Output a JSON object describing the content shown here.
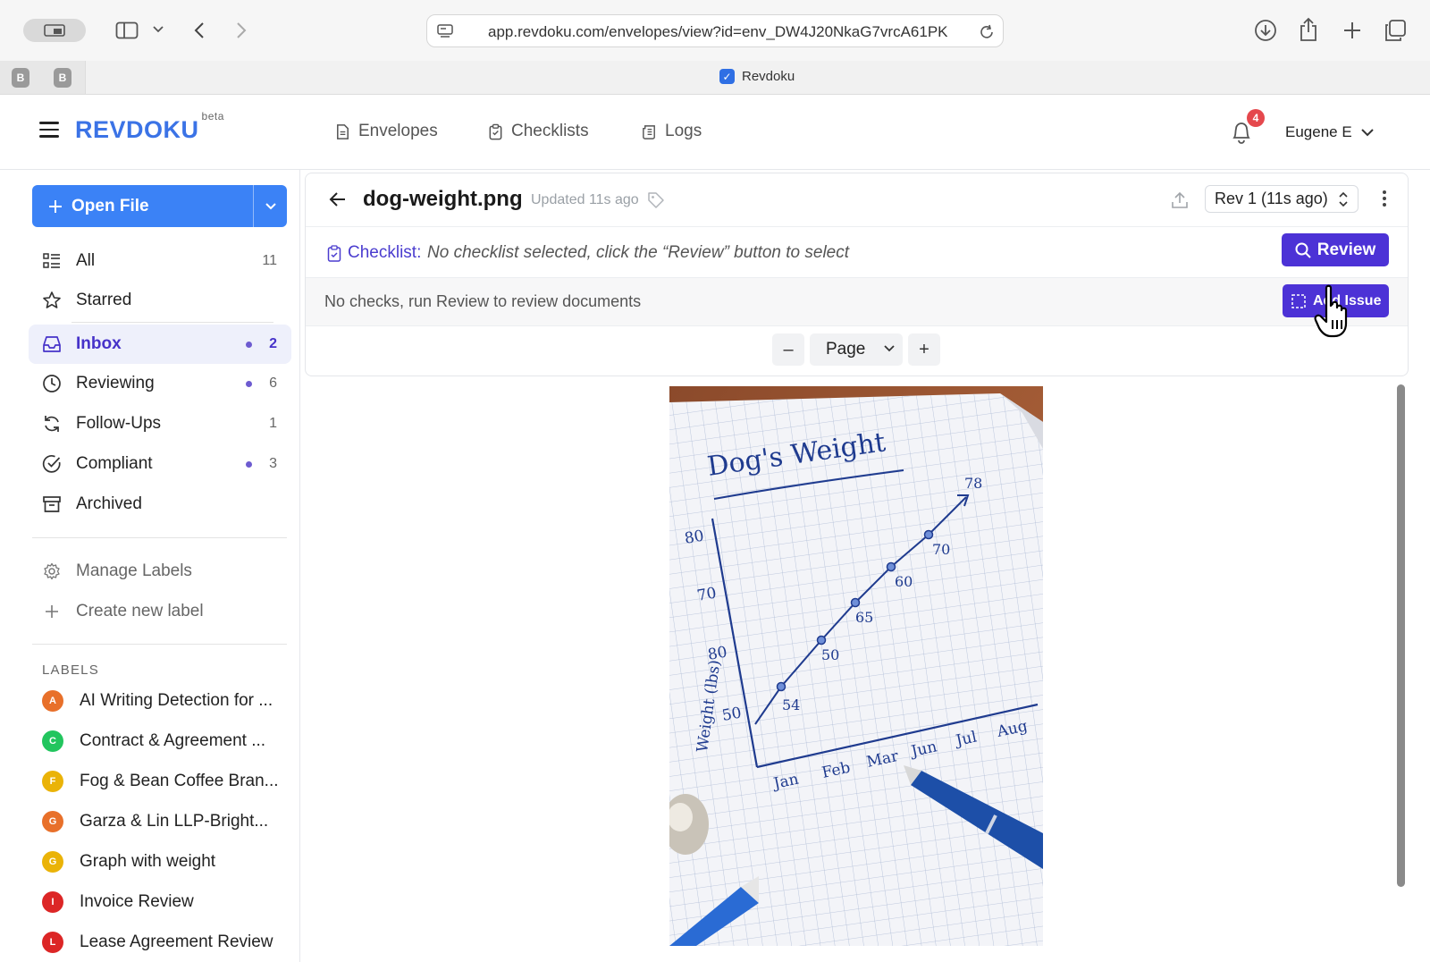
{
  "browser": {
    "url": "app.revdoku.com/envelopes/view?id=env_DW4J20NkaG7vrcA61PK",
    "pinned_tabs": [
      "B",
      "B"
    ],
    "active_tab_title": "Revdoku"
  },
  "header": {
    "logo": "REVDOKU",
    "logo_sup": "beta",
    "nav": [
      {
        "label": "Envelopes",
        "icon": "document-icon"
      },
      {
        "label": "Checklists",
        "icon": "clipboard-icon"
      },
      {
        "label": "Logs",
        "icon": "logs-icon"
      }
    ],
    "notifications_count": "4",
    "user_name": "Eugene E"
  },
  "sidebar": {
    "open_file_label": "Open File",
    "items": [
      {
        "label": "All",
        "count": "11",
        "dot": false,
        "icon": "list-icon"
      },
      {
        "label": "Starred",
        "count": "",
        "dot": false,
        "icon": "star-icon"
      },
      {
        "label": "Inbox",
        "count": "2",
        "dot": true,
        "icon": "inbox-icon"
      },
      {
        "label": "Reviewing",
        "count": "6",
        "dot": true,
        "icon": "clock-icon"
      },
      {
        "label": "Follow-Ups",
        "count": "1",
        "dot": false,
        "icon": "refresh-icon"
      },
      {
        "label": "Compliant",
        "count": "3",
        "dot": true,
        "icon": "check-circle-icon"
      },
      {
        "label": "Archived",
        "count": "",
        "dot": false,
        "icon": "archive-icon"
      }
    ],
    "manage_labels": "Manage Labels",
    "create_label": "Create new label",
    "labels_heading": "LABELS",
    "labels": [
      {
        "letter": "A",
        "name": "AI Writing Detection for ...",
        "color": "#e8702a"
      },
      {
        "letter": "C",
        "name": "Contract & Agreement ...",
        "color": "#22c55e"
      },
      {
        "letter": "F",
        "name": "Fog & Bean Coffee Bran...",
        "color": "#eab308"
      },
      {
        "letter": "G",
        "name": "Garza & Lin LLP-Bright...",
        "color": "#e8702a"
      },
      {
        "letter": "G",
        "name": "Graph with weight",
        "color": "#eab308"
      },
      {
        "letter": "I",
        "name": "Invoice Review",
        "color": "#dc2626"
      },
      {
        "letter": "L",
        "name": "Lease Agreement Review",
        "color": "#dc2626"
      }
    ]
  },
  "document": {
    "title": "dog-weight.png",
    "updated": "Updated 11s ago",
    "revision": "Rev 1 (11s ago)",
    "checklist_label": "Checklist:",
    "checklist_message": "No checklist selected, click the “Review” button to select",
    "review_button": "Review",
    "checks_message": "No checks, run Review to review documents",
    "add_issue_button": "Add Issue",
    "zoom_mode": "Page",
    "zoom_out": "–",
    "zoom_in": "+"
  },
  "photo": {
    "title": "Dog's Weight",
    "ylabel": "Weight (lbs)",
    "y_ticks": [
      "80",
      "70",
      "80",
      "50"
    ],
    "x_ticks": [
      "Jan",
      "Feb",
      "Mar",
      "Jun",
      "Jul",
      "Aug"
    ],
    "point_labels": [
      "54",
      "50",
      "65",
      "60",
      "70",
      "78"
    ]
  },
  "colors": {
    "brand_blue": "#3b73e6",
    "primary_purple": "#4c32d6",
    "ink_blue": "#1f3b8f"
  }
}
